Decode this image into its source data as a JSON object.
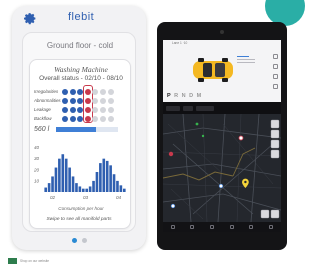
{
  "colors": {
    "accent_teal": "#2aaea6",
    "brand_blue": "#2f5fb0",
    "alert_red": "#c8394c",
    "car_yellow": "#f4b822",
    "map_background": "#24272d",
    "tablet_frame": "#141416"
  },
  "phone": {
    "brand": "flebit",
    "floor_title": "Ground floor - cold",
    "machine_name": "Washing Machine",
    "overall_status": "Overall status - 02/10 - 08/10",
    "status_rows": [
      {
        "label": "Irregolarities",
        "dots": [
          "blue",
          "blue",
          "blue",
          "red",
          "grey",
          "grey",
          "grey"
        ]
      },
      {
        "label": "Abnormalities",
        "dots": [
          "blue",
          "blue",
          "blue",
          "red",
          "grey",
          "grey",
          "grey"
        ]
      },
      {
        "label": "Leakage",
        "dots": [
          "blue",
          "blue",
          "blue",
          "red",
          "grey",
          "grey",
          "grey"
        ]
      },
      {
        "label": "Backflow",
        "dots": [
          "blue",
          "blue",
          "blue",
          "red",
          "grey",
          "grey",
          "grey"
        ]
      }
    ],
    "energy_value": "560 l",
    "energy_fill_fraction": 0.65,
    "swipe_hint": "Swipe to see all manifold parts",
    "pager": {
      "count": 2,
      "active_index": 0
    }
  },
  "chart_data": {
    "type": "area",
    "caption": "Consumption per hour",
    "y_ticks": [
      "40",
      "30",
      "20",
      "10"
    ],
    "x_ticks": [
      "02",
      "03",
      "04"
    ],
    "ylim": [
      0,
      45
    ],
    "series": [
      {
        "values": [
          4,
          8,
          14,
          22,
          30,
          34,
          30,
          22,
          14,
          8,
          5,
          3,
          3,
          5,
          10,
          18,
          26,
          30,
          28,
          24,
          16,
          10,
          6,
          3
        ]
      }
    ]
  },
  "tablet": {
    "status_text": "Lane 1 ·10",
    "gears": [
      "P",
      "R",
      "N",
      "D",
      "M"
    ],
    "active_gear": "P"
  },
  "footer": {
    "caption": "Shop on our website"
  }
}
